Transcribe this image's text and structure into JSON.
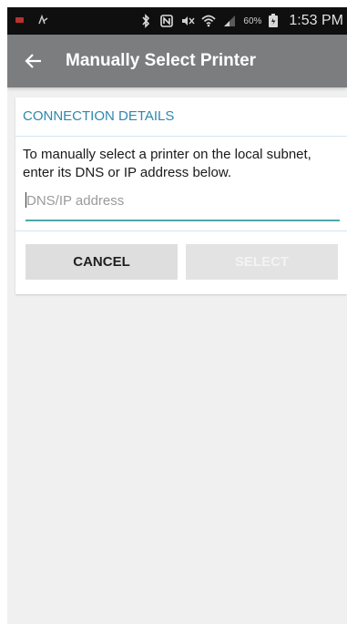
{
  "status_bar": {
    "battery_percent": "60%",
    "time": "1:53 PM",
    "icons": [
      "notification-icon",
      "signal-waves-icon",
      "bluetooth-icon",
      "nfc-icon",
      "mute-icon",
      "wifi-icon",
      "cell-signal-icon",
      "battery-icon"
    ]
  },
  "app_bar": {
    "back_icon": "arrow-left-icon",
    "title": "Manually Select Printer"
  },
  "connection": {
    "section_title": "CONNECTION DETAILS",
    "description": "To manually select a printer on the local subnet, enter its DNS or IP address below.",
    "input_value": "",
    "input_placeholder": "DNS/IP address"
  },
  "actions": {
    "cancel_label": "CANCEL",
    "select_label": "SELECT",
    "select_enabled": false
  },
  "colors": {
    "app_bar": "#7b7d7f",
    "accent": "#2e88ad",
    "input_underline": "#4ea7ad",
    "button_bg": "#dedede"
  }
}
